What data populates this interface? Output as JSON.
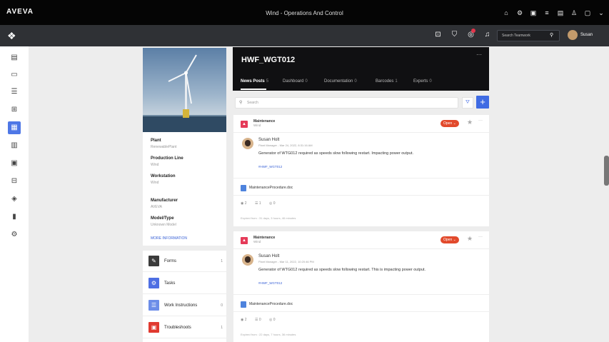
{
  "appbar": {
    "logo": "AVEVA",
    "title": "Wind - Operations And Control",
    "icons": [
      "home-icon",
      "gear-icon",
      "printer-icon",
      "list-icon",
      "document-icon",
      "person-icon",
      "window-icon",
      "chevron-down-icon"
    ]
  },
  "secbar": {
    "icons": [
      "screenshot-icon",
      "shield-icon",
      "notification-icon",
      "bell-icon"
    ],
    "search_placeholder": "Search Teamwork",
    "user_name": "Susan"
  },
  "leftnav": {
    "items": [
      "clipboard-icon",
      "folder-icon",
      "stack-icon",
      "hierarchy-icon",
      "asset-icon",
      "server-icon",
      "monitor-icon",
      "machine-icon",
      "graduation-icon",
      "chart-icon",
      "settings-icon"
    ],
    "active_index": 4
  },
  "asset": {
    "plant_label": "Plant",
    "plant_value": "RenewablePlant",
    "production_label": "Production Line",
    "production_value": "Wind",
    "workstation_label": "Workstation",
    "workstation_value": "Wind",
    "manufacturer_label": "Manufacturer",
    "manufacturer_value": "AVEVA",
    "model_label": "Model/Type",
    "model_value": "Unknown Model",
    "more_info": "MORE INFORMATION"
  },
  "actions": [
    {
      "label": "Forms",
      "count": "1",
      "color": "#3b3b3b",
      "icon": "pencil-icon"
    },
    {
      "label": "Tasks",
      "count": "",
      "color": "#4e6fe3",
      "icon": "gear-icon"
    },
    {
      "label": "Work Instructions",
      "count": "0",
      "color": "#6c8de8",
      "icon": "checklist-icon"
    },
    {
      "label": "Troubleshoots",
      "count": "1",
      "color": "#e0392f",
      "icon": "toolbox-icon"
    }
  ],
  "header": {
    "title": "HWF_WGT012",
    "tabs": [
      {
        "label": "News Posts",
        "count": "5"
      },
      {
        "label": "Dashboard",
        "count": "0"
      },
      {
        "label": "Documentation",
        "count": "0"
      },
      {
        "label": "Barcodes",
        "count": "1"
      },
      {
        "label": "Experts",
        "count": "0"
      }
    ]
  },
  "feed": {
    "search_placeholder": "Search",
    "add_label": "+"
  },
  "posts": [
    {
      "category": "Maintenance",
      "sub": "Wind",
      "status": "Open",
      "author": "Susan Holt",
      "meta": "Plant Manager - Mar 24, 2022, 8:31:16 AM",
      "body": "Generator of WTG012 required as speeds slow following restart. Impacting power output.",
      "tag": "#HWF_WGT012",
      "doc": "MaintenanceProcedure.doc",
      "views": "2",
      "comments": "1",
      "links": "0",
      "expiry": "Expired from : 31 days, 3 hours, 46 minutes"
    },
    {
      "category": "Maintenance",
      "sub": "Wind",
      "status": "Open",
      "author": "Susan Holt",
      "meta": "Plant Manager - Mar 11, 2022, 10:20:46 PM",
      "body": "Generator of WTG012 required as speeds slow following restart. This is impacting power output.",
      "tag": "#HWF_WGT012",
      "doc": "MaintenanceProcedure.doc",
      "views": "2",
      "comments": "0",
      "links": "0",
      "expiry": "Expired from : 22 days, 7 hours, 36 minutes"
    }
  ]
}
